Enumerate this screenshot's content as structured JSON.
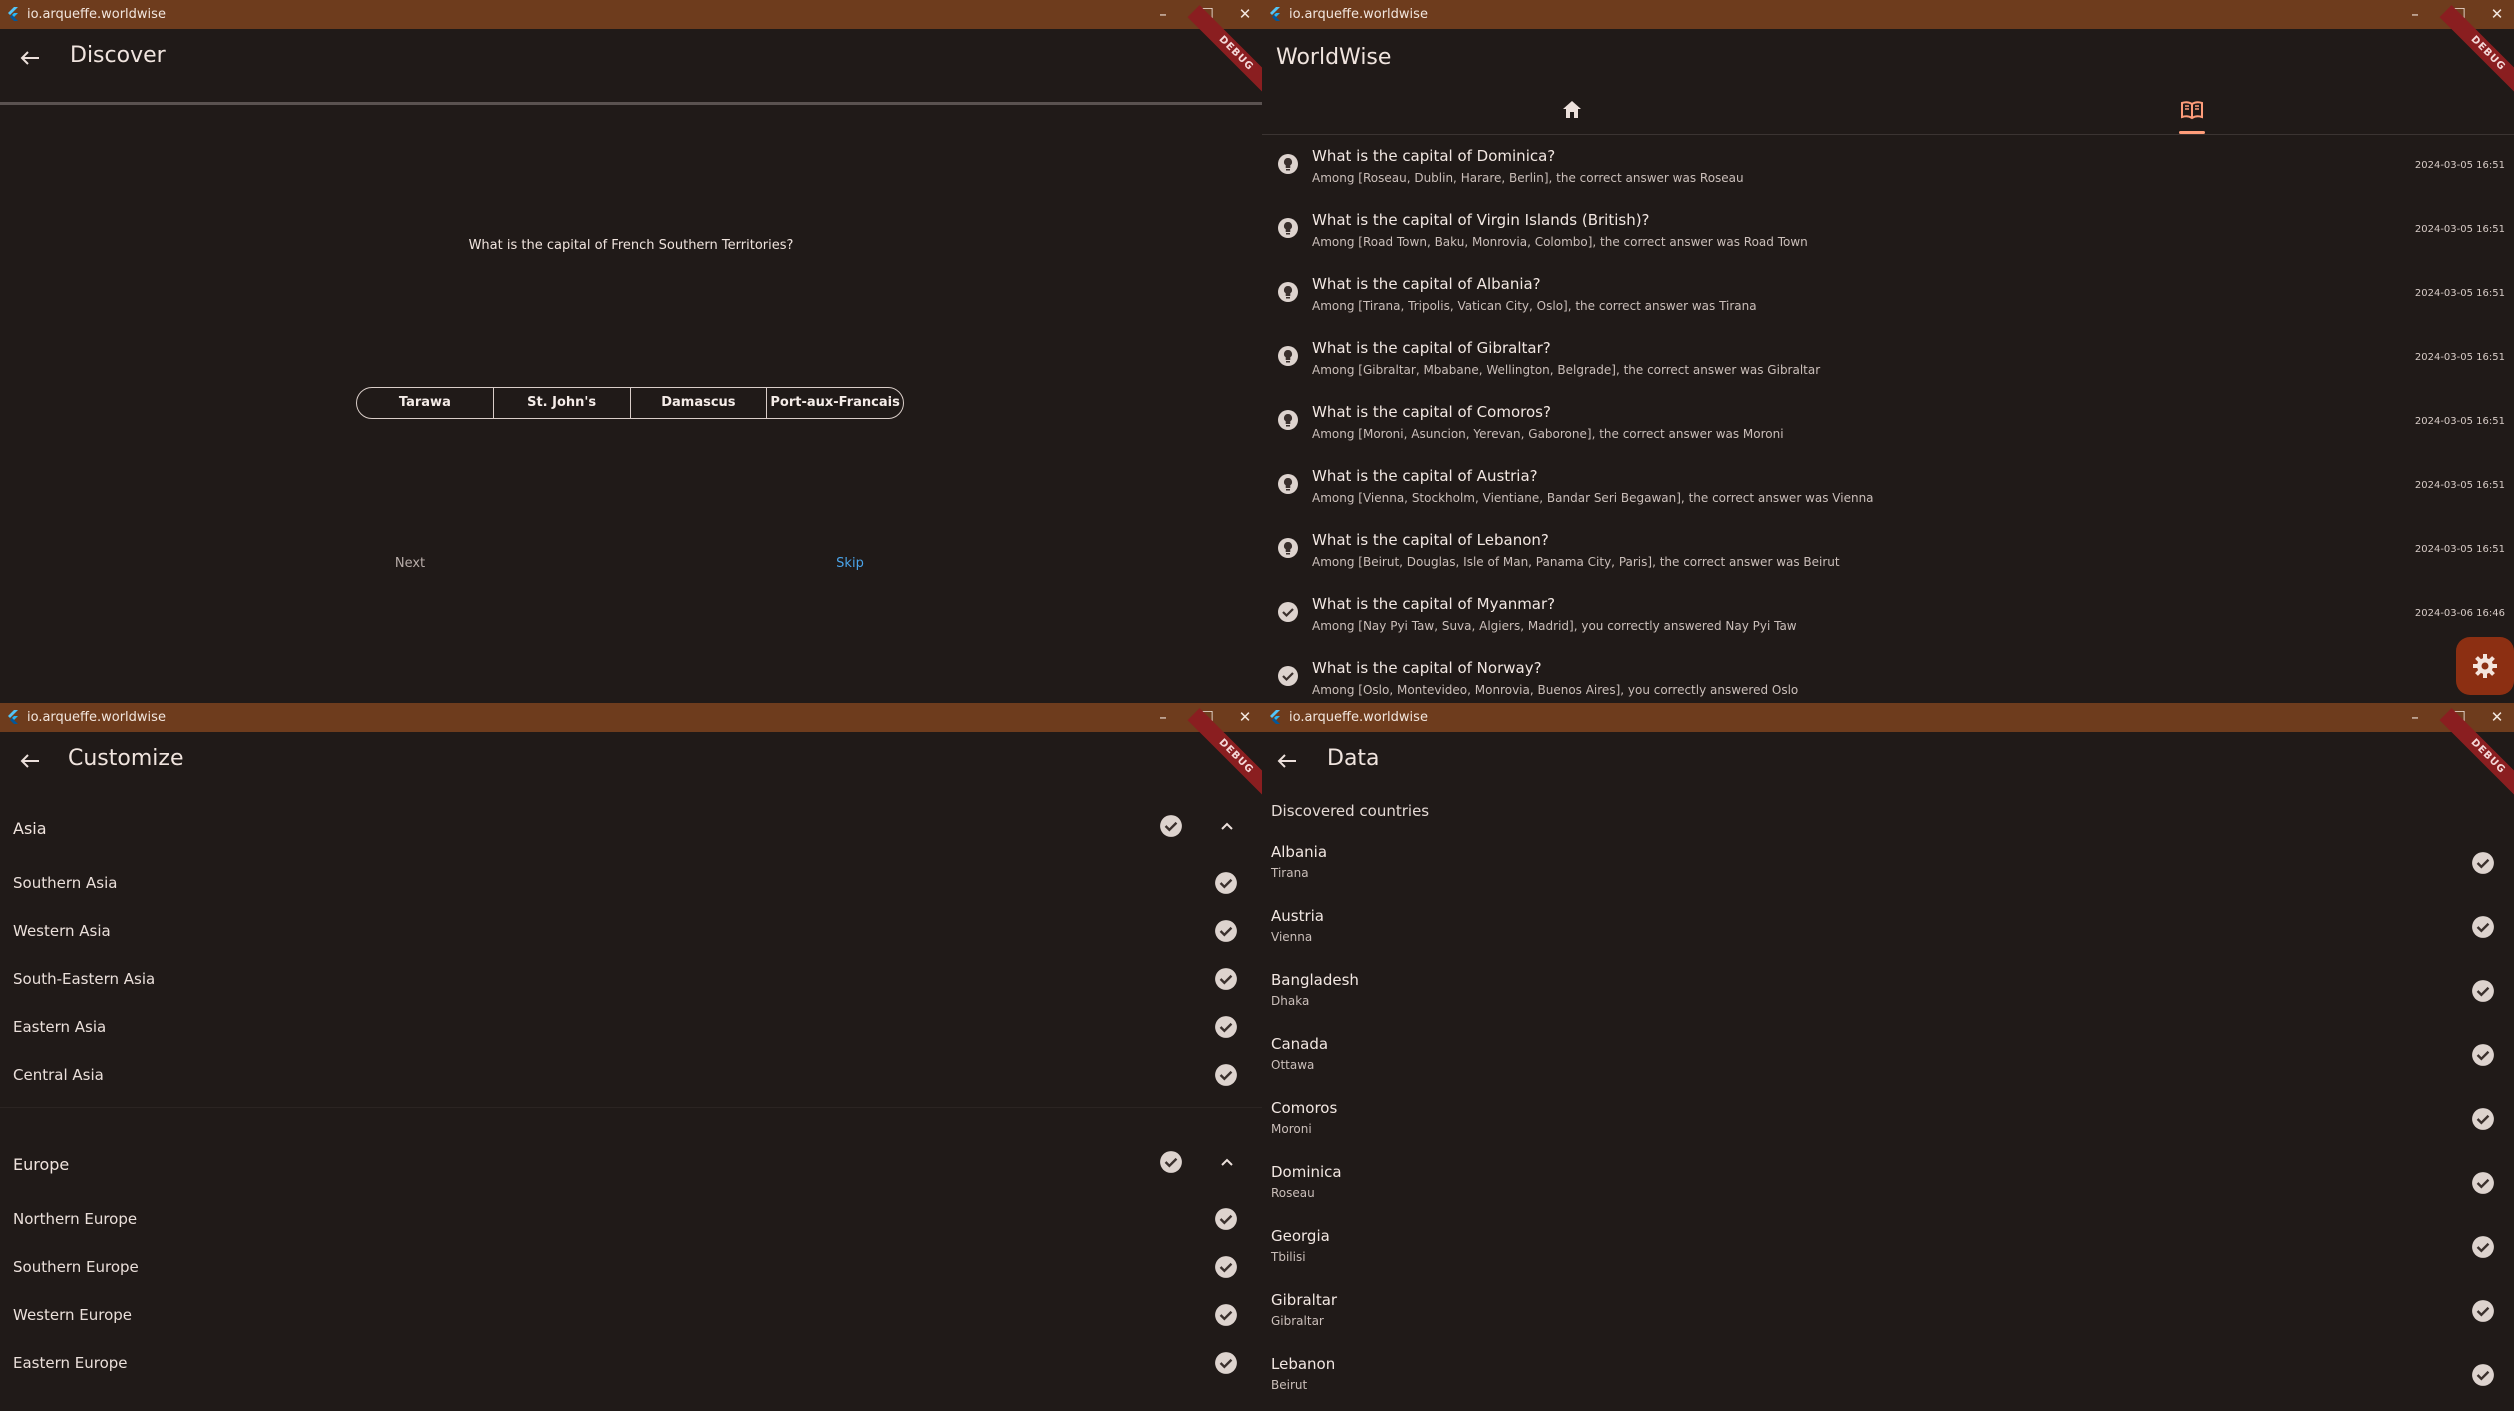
{
  "colors": {
    "titlebar": "#6e3c1d",
    "background": "#201a18",
    "accent": "#ff9d7a",
    "link": "#4aa3e8",
    "fab": "#8c2f12",
    "debug": "#8a1e20"
  },
  "windows": {
    "discover": {
      "window_title": "io.arqueffe.worldwise",
      "page_title": "Discover",
      "debug": "DEBUG",
      "question": "What is the capital of French Southern Territories?",
      "answers": [
        "Tarawa",
        "St. John's",
        "Damascus",
        "Port-aux-Francais"
      ],
      "next_label": "Next",
      "skip_label": "Skip"
    },
    "history": {
      "window_title": "io.arqueffe.worldwise",
      "page_title": "WorldWise",
      "debug": "DEBUG",
      "tabs": [
        "home-icon",
        "book-icon"
      ],
      "items": [
        {
          "icon": "lightbulb-icon",
          "title": "What is the capital of Dominica?",
          "subtitle": "Among [Roseau, Dublin, Harare, Berlin], the correct answer was Roseau",
          "time": "2024-03-05 16:51"
        },
        {
          "icon": "lightbulb-icon",
          "title": "What is the capital of Virgin Islands (British)?",
          "subtitle": "Among [Road Town, Baku, Monrovia, Colombo], the correct answer was Road Town",
          "time": "2024-03-05 16:51"
        },
        {
          "icon": "lightbulb-icon",
          "title": "What is the capital of Albania?",
          "subtitle": "Among [Tirana, Tripolis, Vatican City, Oslo], the correct answer was Tirana",
          "time": "2024-03-05 16:51"
        },
        {
          "icon": "lightbulb-icon",
          "title": "What is the capital of Gibraltar?",
          "subtitle": "Among [Gibraltar, Mbabane, Wellington, Belgrade], the correct answer was Gibraltar",
          "time": "2024-03-05 16:51"
        },
        {
          "icon": "lightbulb-icon",
          "title": "What is the capital of Comoros?",
          "subtitle": "Among [Moroni, Asuncion, Yerevan, Gaborone], the correct answer was Moroni",
          "time": "2024-03-05 16:51"
        },
        {
          "icon": "lightbulb-icon",
          "title": "What is the capital of Austria?",
          "subtitle": "Among [Vienna, Stockholm, Vientiane, Bandar Seri Begawan], the correct answer was Vienna",
          "time": "2024-03-05 16:51"
        },
        {
          "icon": "lightbulb-icon",
          "title": "What is the capital of Lebanon?",
          "subtitle": "Among [Beirut, Douglas, Isle of Man, Panama City, Paris], the correct answer was Beirut",
          "time": "2024-03-05 16:51"
        },
        {
          "icon": "check-icon",
          "title": "What is the capital of Myanmar?",
          "subtitle": "Among [Nay Pyi Taw, Suva, Algiers, Madrid], you correctly answered Nay Pyi Taw",
          "time": "2024-03-06 16:46"
        },
        {
          "icon": "check-icon",
          "title": "What is the capital of Norway?",
          "subtitle": "Among [Oslo, Montevideo, Monrovia, Buenos Aires], you correctly answered Oslo",
          "time": "2024-03"
        }
      ],
      "fab_icon": "settings-icon"
    },
    "customize": {
      "window_title": "io.arqueffe.worldwise",
      "page_title": "Customize",
      "debug": "DEBUG",
      "sections": [
        {
          "title": "Asia",
          "items": [
            "Southern Asia",
            "Western Asia",
            "South-Eastern Asia",
            "Eastern Asia",
            "Central Asia"
          ]
        },
        {
          "title": "Europe",
          "items": [
            "Northern Europe",
            "Southern Europe",
            "Western Europe",
            "Eastern Europe"
          ]
        }
      ]
    },
    "data": {
      "window_title": "io.arqueffe.worldwise",
      "page_title": "Data",
      "debug": "DEBUG",
      "header": "Discovered countries",
      "countries": [
        {
          "name": "Albania",
          "capital": "Tirana"
        },
        {
          "name": "Austria",
          "capital": "Vienna"
        },
        {
          "name": "Bangladesh",
          "capital": "Dhaka"
        },
        {
          "name": "Canada",
          "capital": "Ottawa"
        },
        {
          "name": "Comoros",
          "capital": "Moroni"
        },
        {
          "name": "Dominica",
          "capital": "Roseau"
        },
        {
          "name": "Georgia",
          "capital": "Tbilisi"
        },
        {
          "name": "Gibraltar",
          "capital": "Gibraltar"
        },
        {
          "name": "Lebanon",
          "capital": "Beirut"
        }
      ]
    }
  }
}
